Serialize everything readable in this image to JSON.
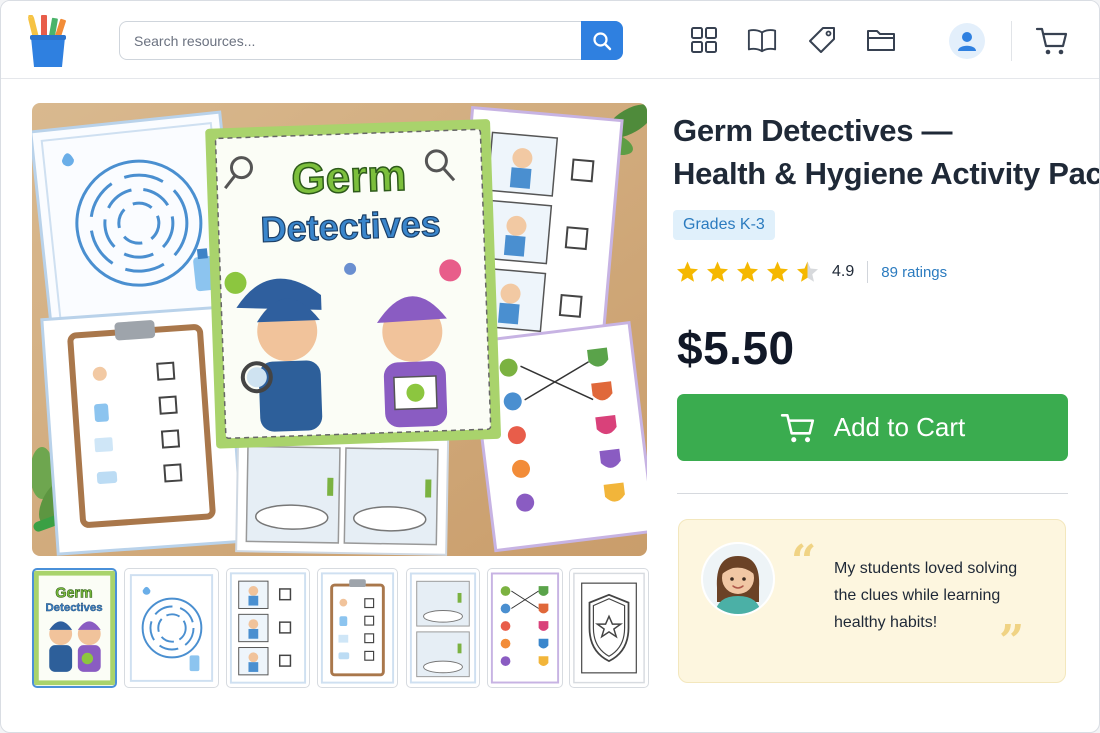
{
  "search": {
    "placeholder": "Search resources..."
  },
  "header_icons": [
    "search-icon",
    "grid-icon",
    "book-icon",
    "tag-icon",
    "folder-icon",
    "user-icon",
    "cart-icon"
  ],
  "product": {
    "cover_title_line1": "Germ",
    "cover_title_line2": "Detectives",
    "title_line1": "Germ Detectives —",
    "title_line2": "Health & Hygiene Activity Pack",
    "grade_badge": "Grades K-3",
    "rating_value": "4.9",
    "rating_stars": 4.5,
    "rating_count": "89 ratings",
    "price": "$5.50"
  },
  "thumbnails": {
    "count": 7,
    "active_index": 0,
    "cover_line1": "Germ",
    "cover_line2": "Detectives"
  },
  "cart_button": {
    "label": "Add to Cart"
  },
  "testimonial": {
    "quote_open": "“",
    "quote_close": "”",
    "line1": "My students loved solving",
    "line2": "the clues while learning",
    "line3": "healthy habits!"
  },
  "colors": {
    "accent_blue": "#2f80e0",
    "cart_green": "#3aac4f",
    "star_gold": "#f5b800",
    "badge_bg": "#e0f0fb",
    "badge_text": "#2b7bbf",
    "testimonial_bg": "#fdf6df"
  }
}
